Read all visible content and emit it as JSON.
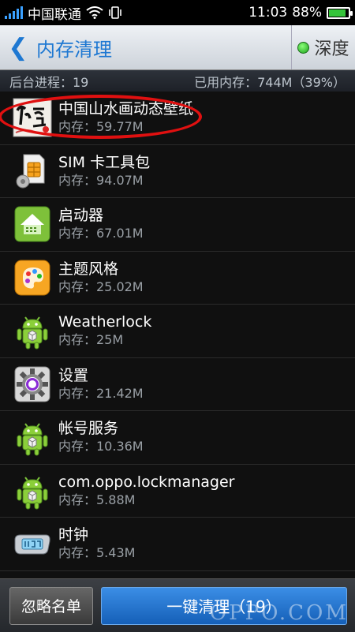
{
  "status": {
    "carrier": "中国联通",
    "time": "11:03",
    "battery": "88%",
    "battery_level": 0.88
  },
  "header": {
    "back_symbol": "❮",
    "title": "内存清理",
    "deep_label": "深度"
  },
  "info": {
    "process_label": "后台进程：19",
    "mem_label": "已用内存：744M（39%）"
  },
  "apps": [
    {
      "name": "中国山水画动态壁纸",
      "mem": "内存：59.77M",
      "icon": "landscape-wallpaper-icon"
    },
    {
      "name": "SIM 卡工具包",
      "mem": "内存：94.07M",
      "icon": "sim-card-icon"
    },
    {
      "name": "启动器",
      "mem": "内存：67.01M",
      "icon": "launcher-icon"
    },
    {
      "name": "主题风格",
      "mem": "内存：25.02M",
      "icon": "theme-palette-icon"
    },
    {
      "name": "Weatherlock",
      "mem": "内存：25M",
      "icon": "android-icon"
    },
    {
      "name": "设置",
      "mem": "内存：21.42M",
      "icon": "settings-gear-icon"
    },
    {
      "name": "帐号服务",
      "mem": "内存：10.36M",
      "icon": "android-icon"
    },
    {
      "name": "com.oppo.lockmanager",
      "mem": "内存：5.88M",
      "icon": "android-icon"
    },
    {
      "name": "时钟",
      "mem": "内存：5.43M",
      "icon": "clock-icon"
    }
  ],
  "footer": {
    "ignore_label": "忽略名单",
    "clean_label": "一键清理（19）"
  },
  "watermark": "OPPO.COM"
}
